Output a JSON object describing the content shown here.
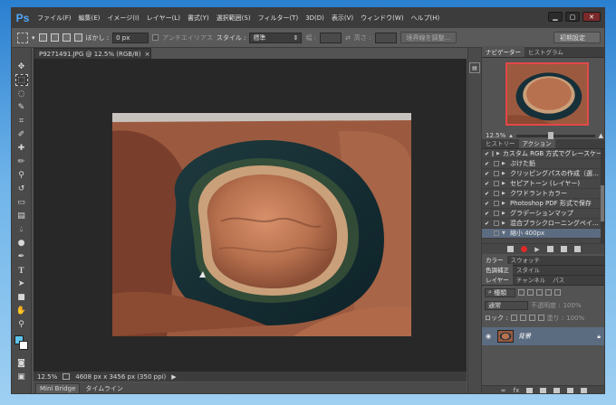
{
  "app": {
    "logo": "Ps"
  },
  "menu": [
    "ファイル(F)",
    "編集(E)",
    "イメージ(I)",
    "レイヤー(L)",
    "書式(Y)",
    "選択範囲(S)",
    "フィルター(T)",
    "3D(D)",
    "表示(V)",
    "ウィンドウ(W)",
    "ヘルプ(H)"
  ],
  "options": {
    "feather_label": "ぼかし :",
    "feather_value": "0 px",
    "antialias_label": "アンチエイリアス",
    "style_label": "スタイル :",
    "style_value": "標準",
    "width_label": "幅 :",
    "height_label": "高さ :",
    "refine_edge_button": "境界線を調整...",
    "workspace_button": "初期設定"
  },
  "document": {
    "tab_title": "P9271491.JPG @ 12.5% (RGB/8)",
    "zoom": "12.5%",
    "dimensions": "4608 px x 3456 px (350 ppi)"
  },
  "bottom_tabs": [
    "Mini Bridge",
    "タイムライン"
  ],
  "navigator": {
    "tabs": [
      "ナビゲーター",
      "ヒストグラム"
    ],
    "zoom": "12.5%"
  },
  "history": {
    "tabs": [
      "ヒストリー",
      "アクション"
    ],
    "items": [
      {
        "label": "カスタム RGB 方式でグレースケール",
        "checked": true
      },
      {
        "label": "ぷけた鉛",
        "checked": true
      },
      {
        "label": "クリッピングパスの作成（選…",
        "checked": true
      },
      {
        "label": "セピアトーン (レイヤー)",
        "checked": true
      },
      {
        "label": "クワドラントカラー",
        "checked": true
      },
      {
        "label": "Photoshop PDF 形式で保存",
        "checked": true
      },
      {
        "label": "グラデーションマップ",
        "checked": true
      },
      {
        "label": "混合ブラシクローニングペイ…",
        "checked": true
      },
      {
        "label": "縮小 400px",
        "checked": false,
        "selected": true
      }
    ]
  },
  "color_tabs": [
    "カラー",
    "スウォッチ"
  ],
  "adjust_tabs": [
    "色調補正",
    "スタイル"
  ],
  "layers": {
    "tabs": [
      "レイヤー",
      "チャンネル",
      "パス"
    ],
    "kind_label": "種類",
    "blend_mode": "通常",
    "opacity_label": "不透明度 :",
    "opacity_value": "100%",
    "lock_label": "ロック :",
    "fill_label": "塗り :",
    "fill_value": "100%",
    "layer_name": "背景"
  }
}
